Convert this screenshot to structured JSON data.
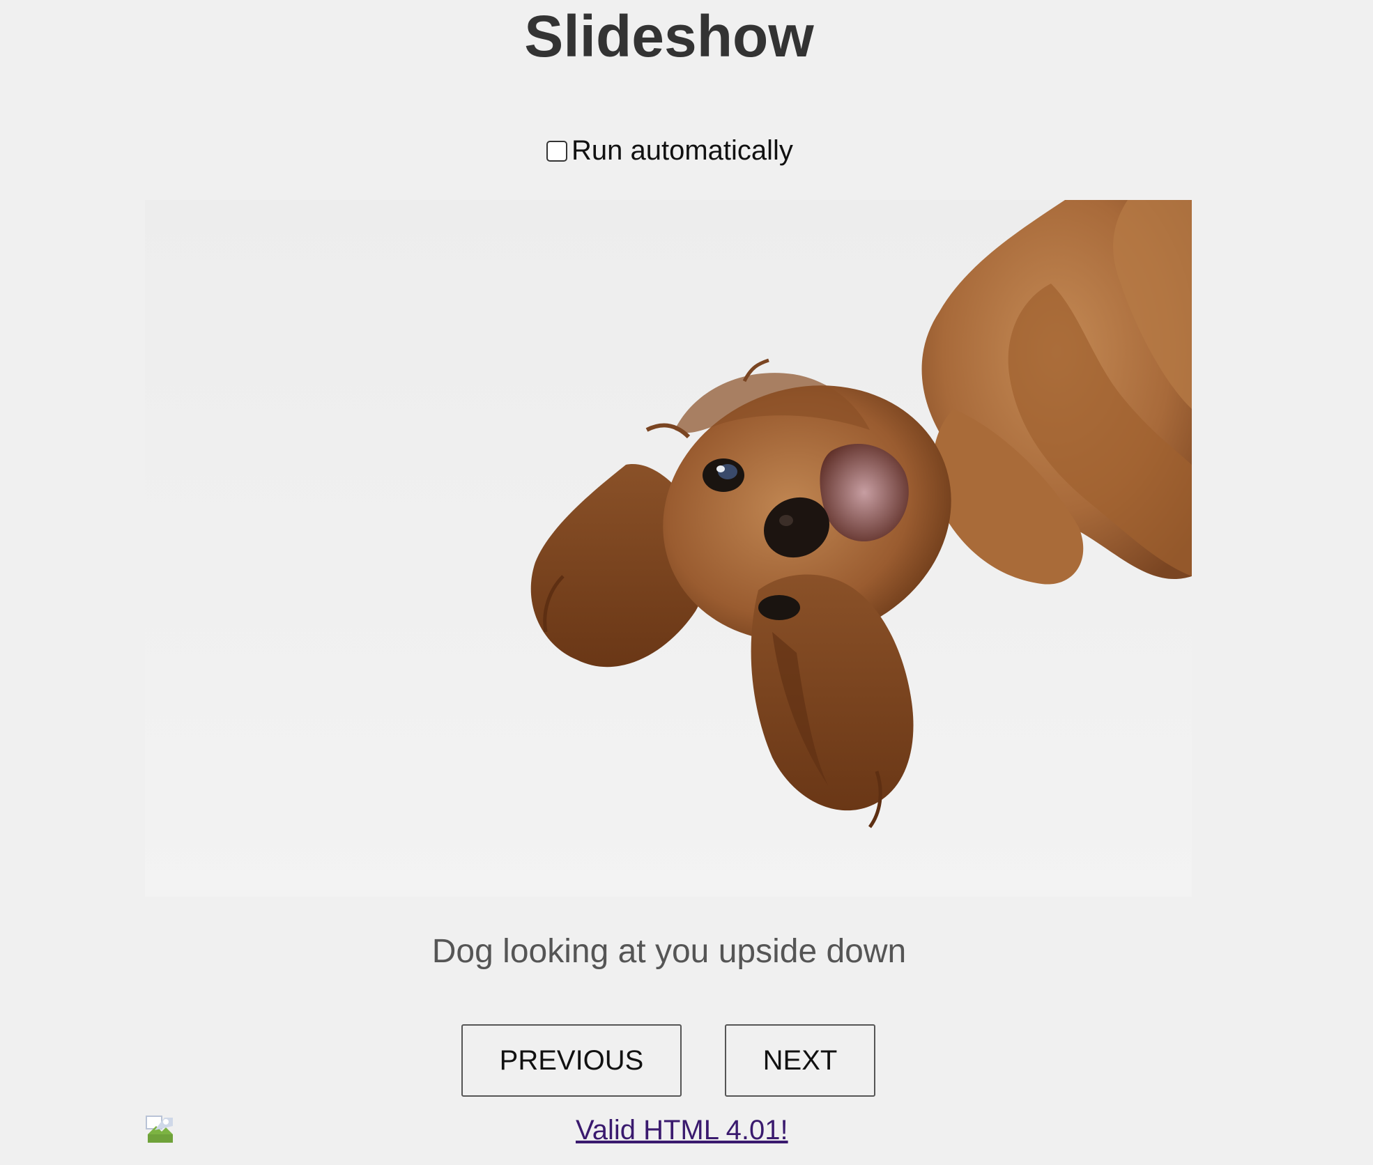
{
  "page": {
    "title": "Slideshow"
  },
  "controls": {
    "run_automatically_label": "Run automatically",
    "run_automatically_checked": false
  },
  "slide": {
    "caption": "Dog looking at you upside down"
  },
  "navigation": {
    "previous_label": "PREVIOUS",
    "next_label": "NEXT"
  },
  "footer": {
    "validator_link_text": "Valid HTML 4.01!"
  },
  "colors": {
    "background": "#f0f0f0",
    "title": "#333333",
    "caption": "#555555",
    "link_visited": "#3a1a6e"
  },
  "icons": {
    "badge": "broken-image-icon"
  }
}
